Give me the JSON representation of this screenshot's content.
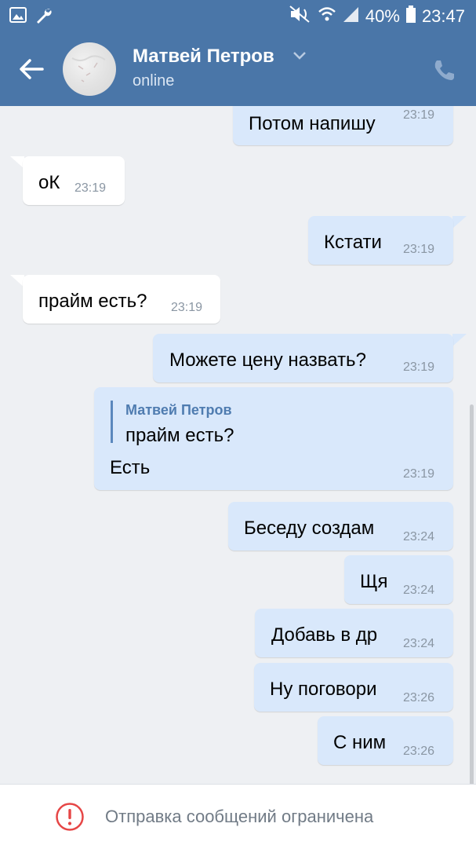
{
  "status_bar": {
    "battery": "40%",
    "time": "23:47",
    "icons": [
      "gallery-icon",
      "wrench-icon",
      "mute-icon",
      "wifi-icon",
      "signal-icon",
      "battery-icon"
    ]
  },
  "header": {
    "name": "Матвей Петров",
    "status": "online",
    "icons": [
      "back-arrow-icon",
      "chevron-down-icon",
      "phone-icon"
    ]
  },
  "messages": [
    {
      "dir": "out",
      "text": "Потом напишу",
      "time": "23:19"
    },
    {
      "dir": "in",
      "text": "оК",
      "time": "23:19"
    },
    {
      "dir": "out",
      "text": "Кстати",
      "time": "23:19"
    },
    {
      "dir": "in",
      "text": "прайм есть?",
      "time": "23:19"
    },
    {
      "dir": "out",
      "text": "Можете цену назвать?",
      "time": "23:19"
    },
    {
      "dir": "out",
      "quote_author": "Матвей Петров",
      "quote_text": "прайм есть?",
      "text": "Есть",
      "time": "23:19"
    },
    {
      "dir": "out",
      "text": "Беседу создам",
      "time": "23:24"
    },
    {
      "dir": "out",
      "text": "Щя",
      "time": "23:24"
    },
    {
      "dir": "out",
      "text": "Добавь в др",
      "time": "23:24"
    },
    {
      "dir": "out",
      "text": "Ну поговори",
      "time": "23:26"
    },
    {
      "dir": "out",
      "text": "С ним",
      "time": "23:26"
    }
  ],
  "bottom": {
    "restricted_text": "Отправка сообщений ограничена"
  },
  "colors": {
    "header_bg": "#4a76a8",
    "outgoing_bubble": "#d9e8fb",
    "incoming_bubble": "#ffffff",
    "warning_red": "#e64646"
  }
}
